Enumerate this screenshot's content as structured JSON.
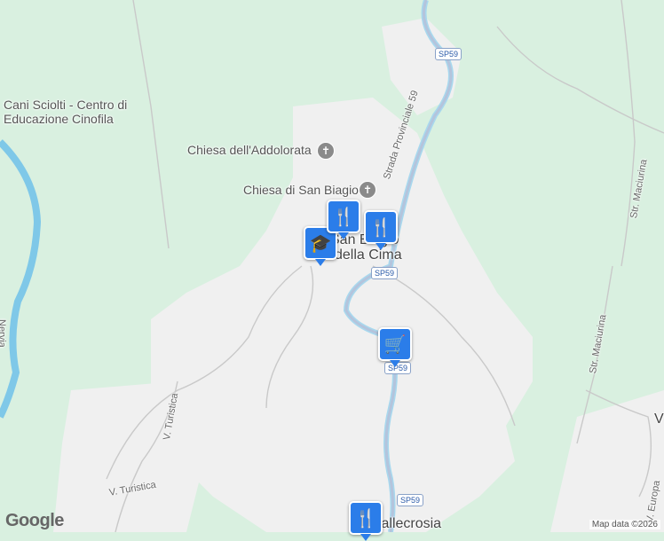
{
  "map": {
    "colors": {
      "land": "#d9f0e0",
      "urban": "#f0f0f0",
      "water": "#7fc8e8",
      "road": "#b4c4dc"
    },
    "labels": {
      "dog_center": "Cani Sciolti - Centro di Educazione Cinofila",
      "addolorata": "Chiesa dell'Addolorata",
      "san_biagio": "Chiesa di San Biagio",
      "sp59_road": "Strada Provinciale 59",
      "village_1": "San Biagio",
      "village_2": "della Cima",
      "river": "Nervia",
      "turistica_1": "V. Turistica",
      "turistica_2": "V. Turistica",
      "maciurina_1": "Str. Maciurina",
      "maciurina_2": "Str. Maciurina",
      "vallecrosia": "Vallecrosia",
      "europa": "V. Europa",
      "v_right": "V"
    },
    "shields": [
      "SP59",
      "SP59",
      "SP59",
      "SP59"
    ],
    "markers": {
      "school": "school-icon",
      "restaurant_1": "restaurant-icon",
      "restaurant_2": "restaurant-icon",
      "shop": "shopping-cart-icon",
      "restaurant_3": "restaurant-icon"
    },
    "church_glyph": "✝",
    "footer": {
      "logo": "Google",
      "attribution": "Map data ©2026"
    }
  }
}
